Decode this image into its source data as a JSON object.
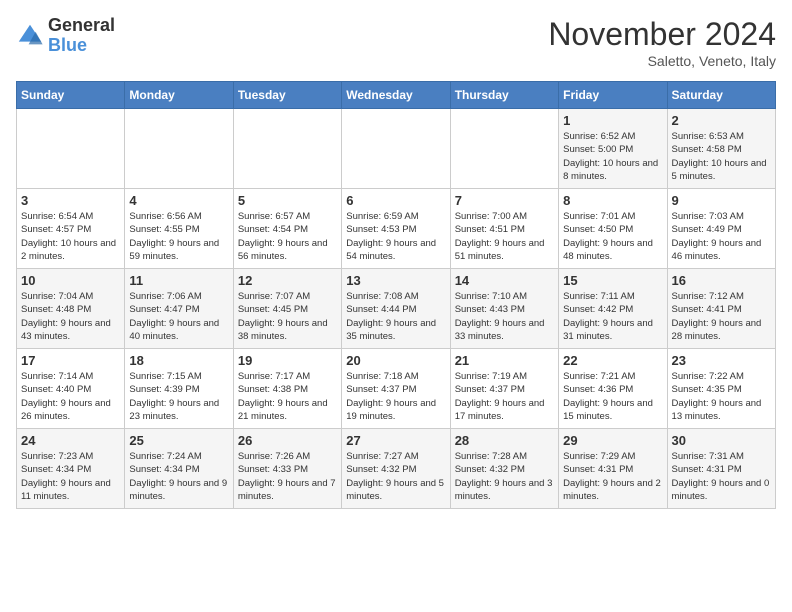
{
  "logo": {
    "general": "General",
    "blue": "Blue"
  },
  "title": "November 2024",
  "subtitle": "Saletto, Veneto, Italy",
  "days_of_week": [
    "Sunday",
    "Monday",
    "Tuesday",
    "Wednesday",
    "Thursday",
    "Friday",
    "Saturday"
  ],
  "weeks": [
    [
      {
        "day": "",
        "info": ""
      },
      {
        "day": "",
        "info": ""
      },
      {
        "day": "",
        "info": ""
      },
      {
        "day": "",
        "info": ""
      },
      {
        "day": "",
        "info": ""
      },
      {
        "day": "1",
        "info": "Sunrise: 6:52 AM\nSunset: 5:00 PM\nDaylight: 10 hours and 8 minutes."
      },
      {
        "day": "2",
        "info": "Sunrise: 6:53 AM\nSunset: 4:58 PM\nDaylight: 10 hours and 5 minutes."
      }
    ],
    [
      {
        "day": "3",
        "info": "Sunrise: 6:54 AM\nSunset: 4:57 PM\nDaylight: 10 hours and 2 minutes."
      },
      {
        "day": "4",
        "info": "Sunrise: 6:56 AM\nSunset: 4:55 PM\nDaylight: 9 hours and 59 minutes."
      },
      {
        "day": "5",
        "info": "Sunrise: 6:57 AM\nSunset: 4:54 PM\nDaylight: 9 hours and 56 minutes."
      },
      {
        "day": "6",
        "info": "Sunrise: 6:59 AM\nSunset: 4:53 PM\nDaylight: 9 hours and 54 minutes."
      },
      {
        "day": "7",
        "info": "Sunrise: 7:00 AM\nSunset: 4:51 PM\nDaylight: 9 hours and 51 minutes."
      },
      {
        "day": "8",
        "info": "Sunrise: 7:01 AM\nSunset: 4:50 PM\nDaylight: 9 hours and 48 minutes."
      },
      {
        "day": "9",
        "info": "Sunrise: 7:03 AM\nSunset: 4:49 PM\nDaylight: 9 hours and 46 minutes."
      }
    ],
    [
      {
        "day": "10",
        "info": "Sunrise: 7:04 AM\nSunset: 4:48 PM\nDaylight: 9 hours and 43 minutes."
      },
      {
        "day": "11",
        "info": "Sunrise: 7:06 AM\nSunset: 4:47 PM\nDaylight: 9 hours and 40 minutes."
      },
      {
        "day": "12",
        "info": "Sunrise: 7:07 AM\nSunset: 4:45 PM\nDaylight: 9 hours and 38 minutes."
      },
      {
        "day": "13",
        "info": "Sunrise: 7:08 AM\nSunset: 4:44 PM\nDaylight: 9 hours and 35 minutes."
      },
      {
        "day": "14",
        "info": "Sunrise: 7:10 AM\nSunset: 4:43 PM\nDaylight: 9 hours and 33 minutes."
      },
      {
        "day": "15",
        "info": "Sunrise: 7:11 AM\nSunset: 4:42 PM\nDaylight: 9 hours and 31 minutes."
      },
      {
        "day": "16",
        "info": "Sunrise: 7:12 AM\nSunset: 4:41 PM\nDaylight: 9 hours and 28 minutes."
      }
    ],
    [
      {
        "day": "17",
        "info": "Sunrise: 7:14 AM\nSunset: 4:40 PM\nDaylight: 9 hours and 26 minutes."
      },
      {
        "day": "18",
        "info": "Sunrise: 7:15 AM\nSunset: 4:39 PM\nDaylight: 9 hours and 23 minutes."
      },
      {
        "day": "19",
        "info": "Sunrise: 7:17 AM\nSunset: 4:38 PM\nDaylight: 9 hours and 21 minutes."
      },
      {
        "day": "20",
        "info": "Sunrise: 7:18 AM\nSunset: 4:37 PM\nDaylight: 9 hours and 19 minutes."
      },
      {
        "day": "21",
        "info": "Sunrise: 7:19 AM\nSunset: 4:37 PM\nDaylight: 9 hours and 17 minutes."
      },
      {
        "day": "22",
        "info": "Sunrise: 7:21 AM\nSunset: 4:36 PM\nDaylight: 9 hours and 15 minutes."
      },
      {
        "day": "23",
        "info": "Sunrise: 7:22 AM\nSunset: 4:35 PM\nDaylight: 9 hours and 13 minutes."
      }
    ],
    [
      {
        "day": "24",
        "info": "Sunrise: 7:23 AM\nSunset: 4:34 PM\nDaylight: 9 hours and 11 minutes."
      },
      {
        "day": "25",
        "info": "Sunrise: 7:24 AM\nSunset: 4:34 PM\nDaylight: 9 hours and 9 minutes."
      },
      {
        "day": "26",
        "info": "Sunrise: 7:26 AM\nSunset: 4:33 PM\nDaylight: 9 hours and 7 minutes."
      },
      {
        "day": "27",
        "info": "Sunrise: 7:27 AM\nSunset: 4:32 PM\nDaylight: 9 hours and 5 minutes."
      },
      {
        "day": "28",
        "info": "Sunrise: 7:28 AM\nSunset: 4:32 PM\nDaylight: 9 hours and 3 minutes."
      },
      {
        "day": "29",
        "info": "Sunrise: 7:29 AM\nSunset: 4:31 PM\nDaylight: 9 hours and 2 minutes."
      },
      {
        "day": "30",
        "info": "Sunrise: 7:31 AM\nSunset: 4:31 PM\nDaylight: 9 hours and 0 minutes."
      }
    ]
  ]
}
